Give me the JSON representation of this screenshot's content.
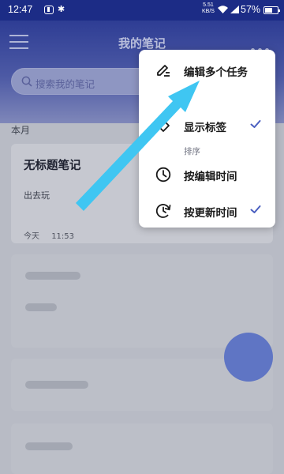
{
  "status_bar": {
    "time": "12:47",
    "bluetooth_glyph": "✱",
    "net_speed_value": "5.51",
    "net_speed_unit": "KB/S",
    "battery_percent": "57%",
    "icons": [
      "sim-icon",
      "bluetooth-icon",
      "wifi-icon",
      "signal-icon",
      "battery-icon"
    ]
  },
  "header": {
    "title": "我的笔记",
    "menu_icon": "hamburger-menu-icon",
    "more_icon": "more-dots-icon"
  },
  "search": {
    "placeholder": "搜索我的笔记",
    "icon": "search-icon"
  },
  "content": {
    "section_label": "本月",
    "note": {
      "title": "无标题笔记",
      "body": "出去玩",
      "date": "今天",
      "time": "11:53"
    }
  },
  "popup_menu": {
    "items": [
      {
        "label": "编辑多个任务",
        "icon": "edit-pencil-icon",
        "checked": false
      },
      {
        "label": "显示标签",
        "icon": "tag-icon",
        "checked": true
      },
      {
        "label": "按编辑时间",
        "icon": "clock-icon",
        "checked": false
      },
      {
        "label": "按更新时间",
        "icon": "clock-refresh-icon",
        "checked": true
      }
    ],
    "section_sort": "排序"
  },
  "colors": {
    "header": "#2e3d94",
    "check": "#4a5fc0",
    "arrow": "#3fc6f2",
    "fab": "#5f75c4"
  }
}
